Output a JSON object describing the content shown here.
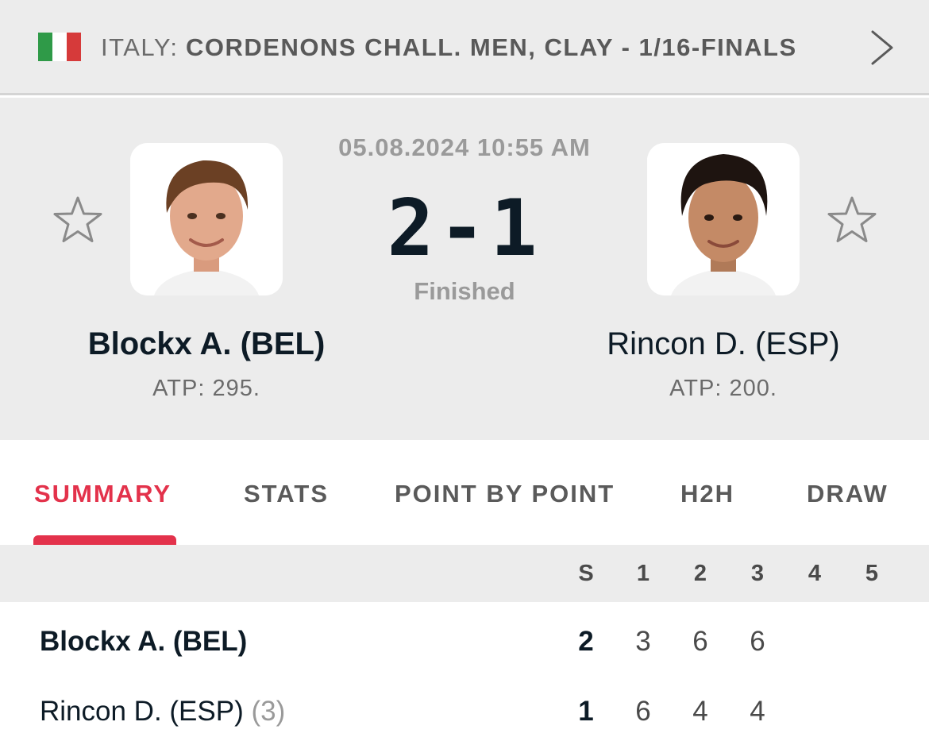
{
  "tournament": {
    "country": "ITALY:",
    "name": "CORDENONS CHALL. MEN, CLAY - 1/16-FINALS",
    "flag_colors": [
      "#2f9a48",
      "#ffffff",
      "#d63a3a"
    ]
  },
  "match": {
    "datetime": "05.08.2024 10:55 AM",
    "score": "2-1",
    "status": "Finished"
  },
  "home": {
    "name": "Blockx A. (BEL)",
    "rank": "ATP: 295."
  },
  "away": {
    "name": "Rincon D. (ESP)",
    "rank": "ATP: 200."
  },
  "tabs": [
    {
      "label": "SUMMARY",
      "active": true
    },
    {
      "label": "STATS",
      "active": false
    },
    {
      "label": "POINT BY POINT",
      "active": false
    },
    {
      "label": "H2H",
      "active": false
    },
    {
      "label": "DRAW",
      "active": false
    }
  ],
  "sets_table": {
    "headers": [
      "S",
      "1",
      "2",
      "3",
      "4",
      "5"
    ],
    "rows": [
      {
        "name": "Blockx A. (BEL)",
        "seed": "",
        "total": "2",
        "sets": [
          "3",
          "6",
          "6"
        ]
      },
      {
        "name": "Rincon D. (ESP)",
        "seed": "(3)",
        "total": "1",
        "sets": [
          "6",
          "4",
          "4"
        ]
      }
    ]
  },
  "colors": {
    "accent": "#e3324b",
    "background": "#ececec",
    "text": "#0d1b26"
  }
}
